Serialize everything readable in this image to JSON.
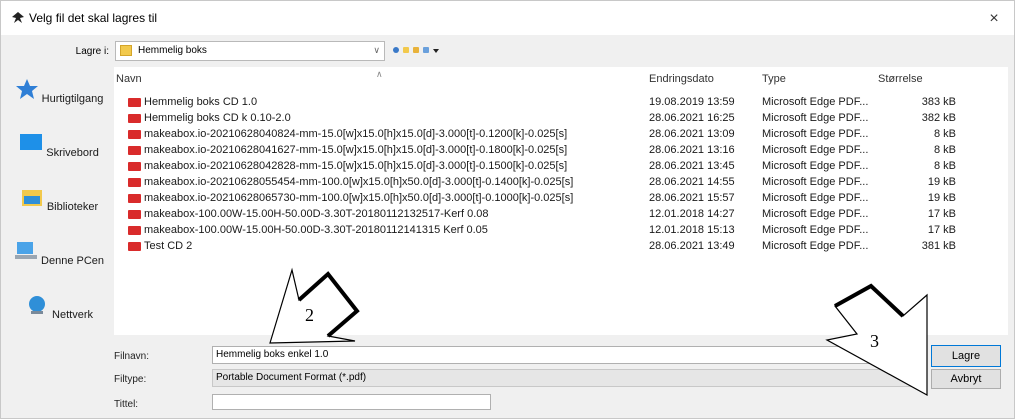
{
  "window": {
    "title": "Velg fil det skal lagres til",
    "close_label": "×"
  },
  "lookin": {
    "label": "Lagre i:",
    "value": "Hemmelig boks"
  },
  "places": [
    {
      "label": "Hurtigtilgang",
      "icon": "star-icon"
    },
    {
      "label": "Skrivebord",
      "icon": "desktop-icon"
    },
    {
      "label": "Biblioteker",
      "icon": "libraries-icon"
    },
    {
      "label": "Denne PCen",
      "icon": "computer-icon"
    },
    {
      "label": "Nettverk",
      "icon": "network-icon"
    }
  ],
  "columns": {
    "name": "Navn",
    "date": "Endringsdato",
    "type": "Type",
    "size": "Størrelse"
  },
  "files": [
    {
      "name": "Hemmelig boks CD 1.0",
      "date": "19.08.2019 13:59",
      "type": "Microsoft Edge PDF...",
      "size": "383 kB"
    },
    {
      "name": "Hemmelig boks CD k 0.10-2.0",
      "date": "28.06.2021 16:25",
      "type": "Microsoft Edge PDF...",
      "size": "382 kB"
    },
    {
      "name": "makeabox.io-20210628040824-mm-15.0[w]x15.0[h]x15.0[d]-3.000[t]-0.1200[k]-0.025[s]",
      "date": "28.06.2021 13:09",
      "type": "Microsoft Edge PDF...",
      "size": "8 kB"
    },
    {
      "name": "makeabox.io-20210628041627-mm-15.0[w]x15.0[h]x15.0[d]-3.000[t]-0.1800[k]-0.025[s]",
      "date": "28.06.2021 13:16",
      "type": "Microsoft Edge PDF...",
      "size": "8 kB"
    },
    {
      "name": "makeabox.io-20210628042828-mm-15.0[w]x15.0[h]x15.0[d]-3.000[t]-0.1500[k]-0.025[s]",
      "date": "28.06.2021 13:45",
      "type": "Microsoft Edge PDF...",
      "size": "8 kB"
    },
    {
      "name": "makeabox.io-20210628055454-mm-100.0[w]x15.0[h]x50.0[d]-3.000[t]-0.1400[k]-0.025[s]",
      "date": "28.06.2021 14:55",
      "type": "Microsoft Edge PDF...",
      "size": "19 kB"
    },
    {
      "name": "makeabox.io-20210628065730-mm-100.0[w]x15.0[h]x50.0[d]-3.000[t]-0.1000[k]-0.025[s]",
      "date": "28.06.2021 15:57",
      "type": "Microsoft Edge PDF...",
      "size": "19 kB"
    },
    {
      "name": "makeabox-100.00W-15.00H-50.00D-3.30T-20180112132517-Kerf 0.08",
      "date": "12.01.2018 14:27",
      "type": "Microsoft Edge PDF...",
      "size": "17 kB"
    },
    {
      "name": "makeabox-100.00W-15.00H-50.00D-3.30T-20180112141315 Kerf 0.05",
      "date": "12.01.2018 15:13",
      "type": "Microsoft Edge PDF...",
      "size": "17 kB"
    },
    {
      "name": "Test CD 2",
      "date": "28.06.2021 13:49",
      "type": "Microsoft Edge PDF...",
      "size": "381 kB"
    }
  ],
  "form": {
    "filename_label": "Filnavn:",
    "filename_value": "Hemmelig boks enkel 1.0",
    "filetype_label": "Filtype:",
    "filetype_value": "Portable Document Format (*.pdf)",
    "title_label": "Tittel:",
    "title_value": ""
  },
  "buttons": {
    "save": "Lagre",
    "cancel": "Avbryt"
  },
  "annotations": {
    "callout_2": "2",
    "callout_3": "3"
  },
  "colors": {
    "pdf_icon": "#d92b2b",
    "folder": "#f2c94c",
    "accent": "#0078d7"
  }
}
